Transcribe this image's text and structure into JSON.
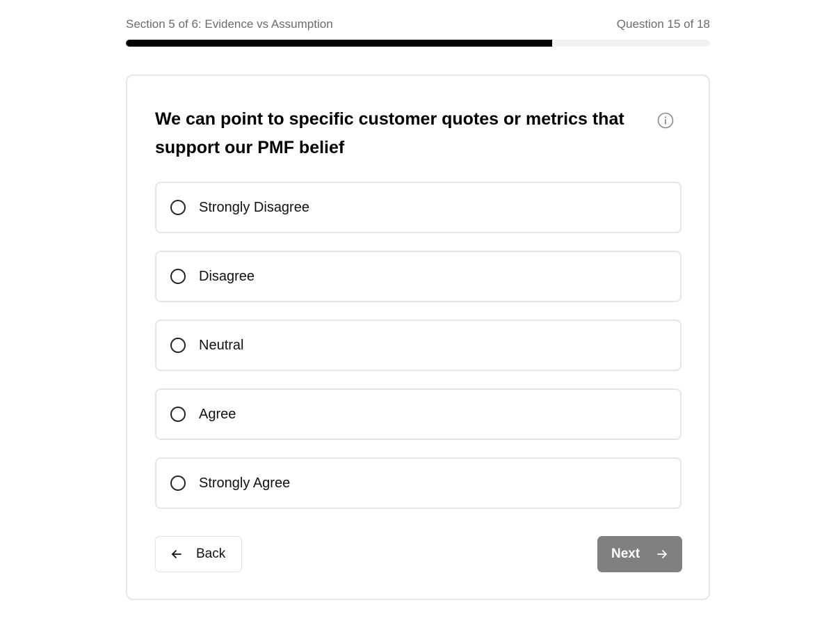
{
  "header": {
    "section_label": "Section 5 of 6: Evidence vs Assumption",
    "question_counter": "Question 15 of 18",
    "progress_fraction": 0.73
  },
  "question": {
    "title": "We can point to specific customer quotes or metrics that support our PMF belief",
    "info_icon": "info-icon"
  },
  "options": [
    {
      "label": "Strongly Disagree",
      "selected": false
    },
    {
      "label": "Disagree",
      "selected": false
    },
    {
      "label": "Neutral",
      "selected": false
    },
    {
      "label": "Agree",
      "selected": false
    },
    {
      "label": "Strongly Agree",
      "selected": false
    }
  ],
  "navigation": {
    "back_label": "Back",
    "back_icon": "arrow-left-icon",
    "next_label": "Next",
    "next_icon": "arrow-right-icon",
    "next_disabled": true
  },
  "colors": {
    "progress_fill": "#000000",
    "progress_track": "#f2f2f2",
    "next_button_disabled": "#808080",
    "border": "#e6e6e6"
  }
}
